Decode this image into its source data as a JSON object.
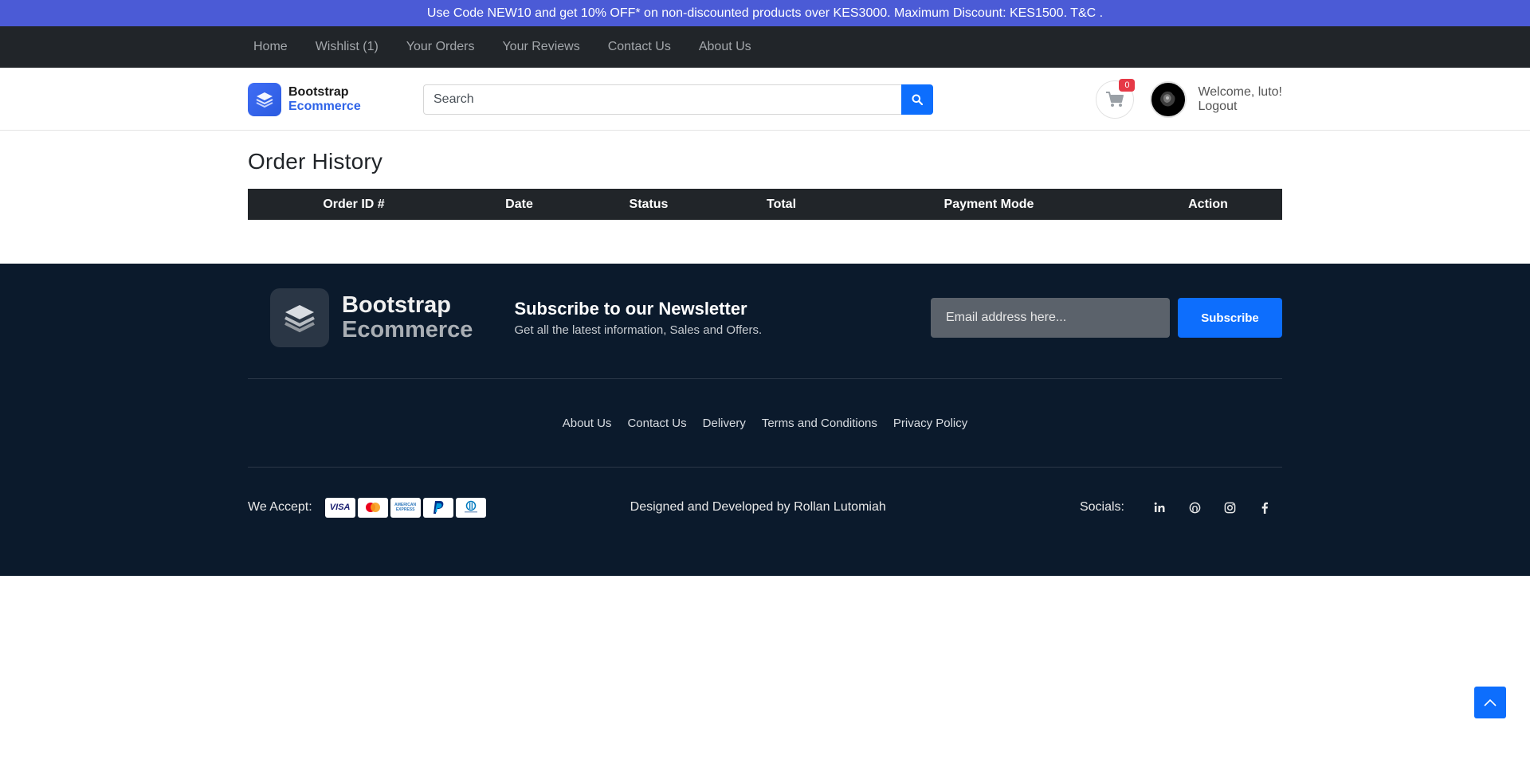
{
  "promo": {
    "text": "Use Code NEW10 and get 10% OFF* on non-discounted products over KES3000. Maximum Discount: KES1500. T&C ."
  },
  "topnav": {
    "items": [
      "Home",
      "Wishlist (1)",
      "Your Orders",
      "Your Reviews",
      "Contact Us",
      "About Us"
    ]
  },
  "header": {
    "brand_line1": "Bootstrap",
    "brand_line2": "Ecommerce",
    "search_placeholder": "Search",
    "cart_count": "0",
    "welcome": "Welcome, luto!",
    "logout": "Logout"
  },
  "main": {
    "title": "Order History",
    "columns": [
      "Order ID #",
      "Date",
      "Status",
      "Total",
      "Payment Mode",
      "Action"
    ]
  },
  "footer": {
    "brand_line1": "Bootstrap",
    "brand_line2": "Ecommerce",
    "newsletter_title": "Subscribe to our Newsletter",
    "newsletter_sub": "Get all the latest information, Sales and Offers.",
    "email_placeholder": "Email address here...",
    "subscribe_label": "Subscribe",
    "links": [
      "About Us",
      "Contact Us",
      "Delivery",
      "Terms and Conditions",
      "Privacy Policy"
    ],
    "accept_label": "We Accept:",
    "cards": [
      "VISA",
      "mastercard",
      "AMERICAN EXPRESS",
      "PayPal",
      "Diners Club"
    ],
    "designed_by": "Designed and Developed by  Rollan Lutomiah",
    "socials_label": "Socials:",
    "socials": [
      "linkedin-icon",
      "github-icon",
      "instagram-icon",
      "facebook-icon"
    ]
  },
  "colors": {
    "promo": "#4b5bd6",
    "nav": "#212529",
    "accent": "#0d6efd",
    "footer": "#0b1a2c",
    "badge": "#e63946"
  }
}
